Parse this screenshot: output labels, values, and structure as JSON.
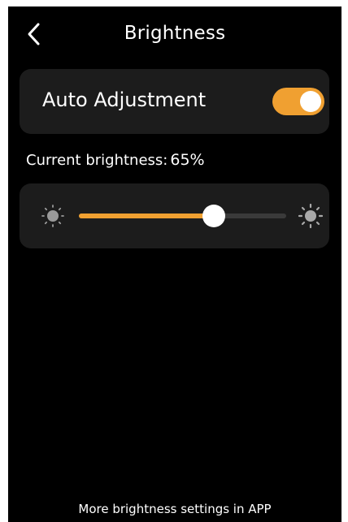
{
  "header": {
    "title": "Brightness",
    "back_icon": "chevron-left-icon"
  },
  "auto_adjustment": {
    "label": "Auto Adjustment",
    "enabled": true
  },
  "brightness": {
    "label": "Current brightness:",
    "value_text": "65%",
    "level": 0.65,
    "min_icon": "sun-dim-icon",
    "max_icon": "sun-bright-icon"
  },
  "footer": {
    "text": "More brightness settings in APP"
  },
  "colors": {
    "accent": "#f0a031",
    "toggle_off": "#555555"
  }
}
